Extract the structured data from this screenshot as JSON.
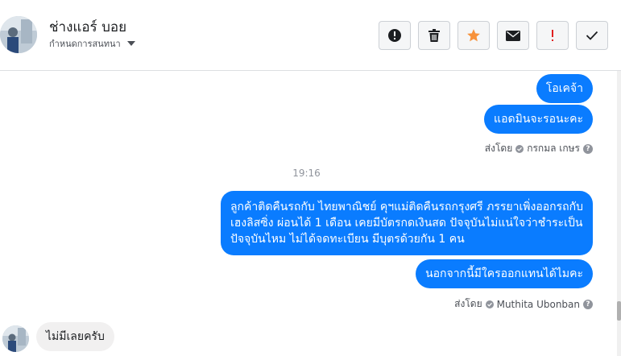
{
  "header": {
    "contact_name": "ช่างแอร์ บอย",
    "conversation_settings": "กำหนดการสนทนา",
    "toolbar": [
      {
        "name": "block-icon"
      },
      {
        "name": "trash-icon"
      },
      {
        "name": "star-icon",
        "color": "#f7923b"
      },
      {
        "name": "envelope-icon"
      },
      {
        "name": "exclamation-icon",
        "color": "#e02020"
      },
      {
        "name": "checkmark-icon"
      }
    ]
  },
  "messages": [
    {
      "direction": "outgoing",
      "text": "โอเคจ้า"
    },
    {
      "direction": "outgoing",
      "text": "แอดมินจะรอนะคะ"
    },
    {
      "type": "sent_by",
      "label": "ส่งโดย",
      "sender": "กรกมล เกษร"
    },
    {
      "type": "timestamp",
      "text": "19:16"
    },
    {
      "direction": "outgoing",
      "lines": [
        "ลูกค้าติดคืนรถกับ ไทยพาณิชย์ คุฯแม่ติดคืนรถกรุงศรี ภรรยาเพิ่งออกรถกับ",
        "เฮงลิสซิ่ง ผ่อนได้ 1 เดือน เคยมีบัตรกดเงินสด ปัจจุบันไม่แน่ใจว่าชำระเป็น",
        "ปัจจุบันไหม ไม่ได้จดทะเบียน มีบุตรด้วยกัน 1 คน"
      ]
    },
    {
      "direction": "outgoing",
      "text": "นอกจากนี้มีใครออกแทนได้ไมคะ"
    },
    {
      "type": "sent_by",
      "label": "ส่งโดย",
      "sender": "Muthita Ubonban"
    },
    {
      "direction": "incoming",
      "text": "ไม่มีเลยครับ"
    }
  ],
  "colors": {
    "outgoing_bubble": "#0a7cff",
    "incoming_bubble": "#f1f0f0"
  }
}
